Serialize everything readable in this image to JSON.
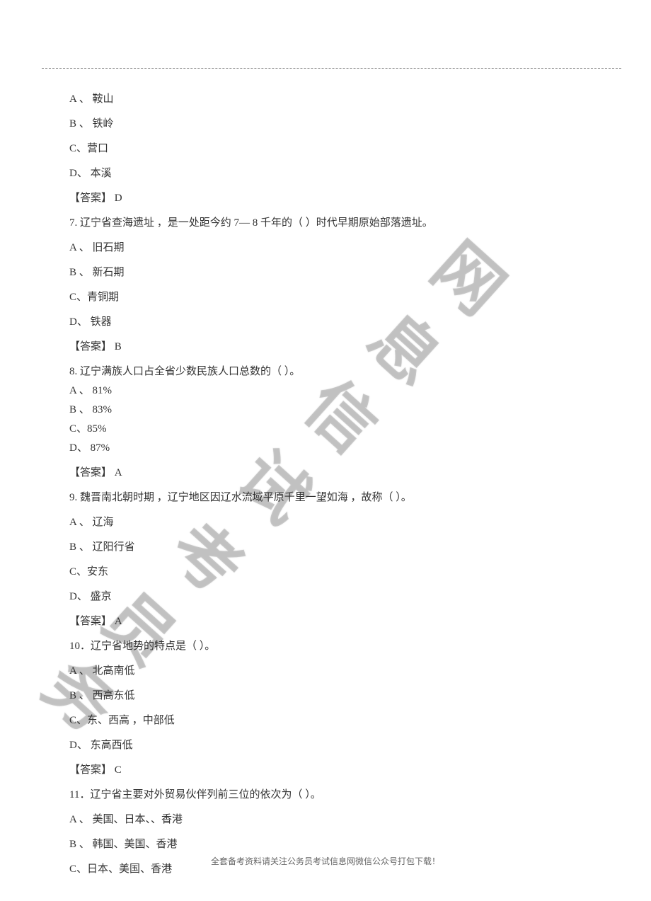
{
  "watermark_chars": [
    "网",
    "息",
    "信",
    "试",
    "考",
    "员",
    "务"
  ],
  "q6": {
    "optA": "A 、 鞍山",
    "optB": "B 、 铁岭",
    "optC": "C、营口",
    "optD": "D、 本溪",
    "answer": "【答案】 D"
  },
  "q7": {
    "stem": "7.    辽宁省查海遗址  ，是一处距今约   7— 8 千年的（          ）时代早期原始部落遗址。",
    "optA": "A 、 旧石期",
    "optB": "B 、 新石期",
    "optC": "C、青铜期",
    "optD": "D、 铁器",
    "answer": "【答案】 B"
  },
  "q8": {
    "stem": "8.    辽宁满族人口占全省少数民族人口总数的（               ）。",
    "optA": "A 、 81%",
    "optB": "B 、 83%",
    "optC": "C、85%",
    "optD": "D、 87%",
    "answer": "【答案】 A"
  },
  "q9": {
    "stem": "9.    魏晋南北朝时期  ，辽宁地区因辽水流域平原千里一望如海      ，故称（         ）。",
    "optA": "A 、 辽海",
    "optB": "B 、 辽阳行省",
    "optC": "C、安东",
    "optD": "D、 盛京",
    "answer": "【答案】 A"
  },
  "q10": {
    "stem": "10．辽宁省地势的特点是（           ）。",
    "optA": "A 、 北高南低",
    "optB": "B 、 西高东低",
    "optC": "C、东、西高 ，中部低",
    "optD": "D、 东高西低",
    "answer": "【答案】 C"
  },
  "q11": {
    "stem": "11．辽宁省主要对外贸易伙伴列前三位的依次为（               ）。",
    "optA": "A 、 美国、日本、、香港",
    "optB": "B 、 韩国、美国、香港",
    "optC": "C、日本、美国、香港"
  },
  "footer": "全套备考资料请关注公务员考试信息网微信公众号打包下载！"
}
